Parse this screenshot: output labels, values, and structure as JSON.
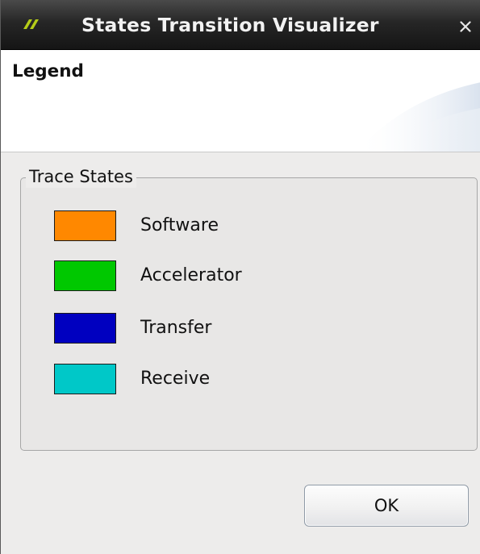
{
  "window": {
    "title": "States Transition Visualizer",
    "close_glyph": "×",
    "logo_icon": "app-logo-icon",
    "close_icon": "close-icon"
  },
  "header": {
    "title": "Legend"
  },
  "trace_states": {
    "group_title": "Trace States",
    "items": [
      {
        "label": "Software",
        "color": "#ff8800"
      },
      {
        "label": "Accelerator",
        "color": "#00c800"
      },
      {
        "label": "Transfer",
        "color": "#0000c0"
      },
      {
        "label": "Receive",
        "color": "#00c8c8"
      }
    ]
  },
  "buttons": {
    "ok_label": "OK"
  },
  "colors": {
    "titlebar": "#1c1c1c",
    "title_text": "#f2f2f2",
    "logo_accent": "#b5cc18",
    "dialog_bg": "#edeceb",
    "header_bg": "#ffffff"
  }
}
